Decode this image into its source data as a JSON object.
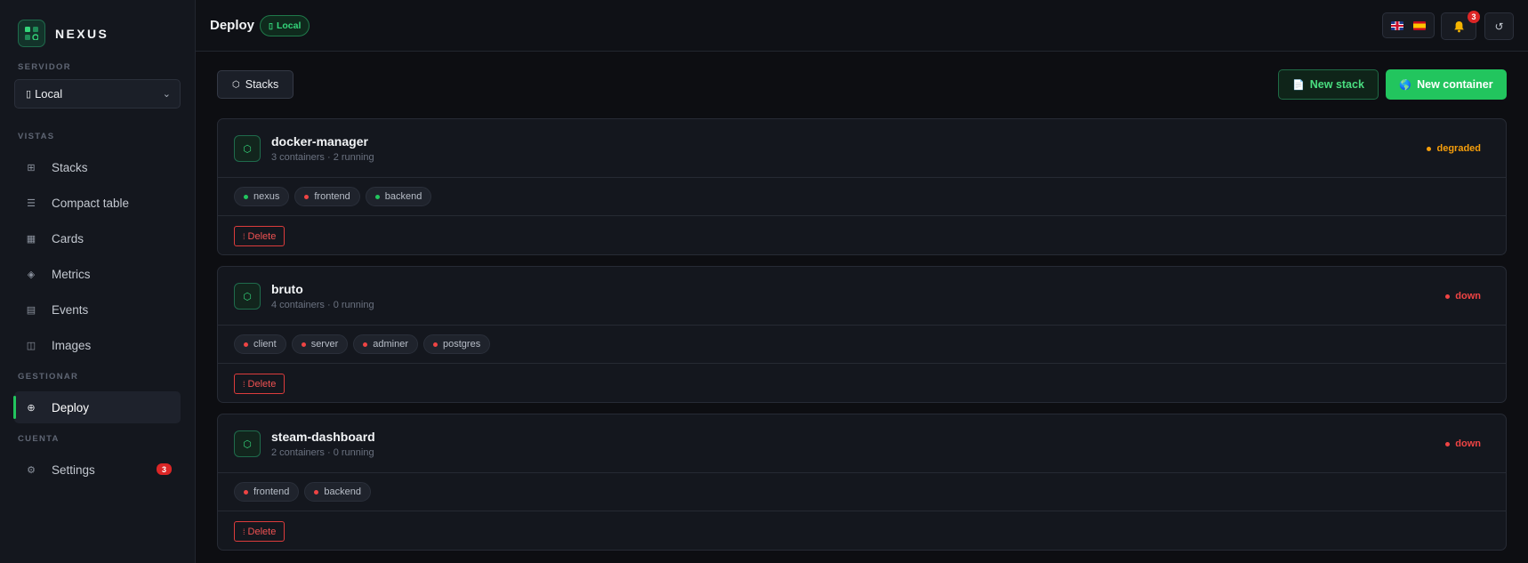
{
  "brand": {
    "name": "NEXUS",
    "logo_icon": "grid-logo-icon"
  },
  "sidebar": {
    "server_label": "SERVIDOR",
    "server_select": {
      "icon": "server-icon",
      "value": "Local"
    },
    "views_label": "VISTAS",
    "manage_label": "GESTIONAR",
    "account_label": "CUENTA",
    "items": [
      {
        "label": "Stacks",
        "icon": "stacks-grid-icon"
      },
      {
        "label": "Compact table",
        "icon": "list-icon"
      },
      {
        "label": "Cards",
        "icon": "cards-icon"
      },
      {
        "label": "Metrics",
        "icon": "metrics-diamond-icon"
      },
      {
        "label": "Events",
        "icon": "events-log-icon"
      },
      {
        "label": "Images",
        "icon": "images-icon"
      },
      {
        "label": "Deploy",
        "icon": "deploy-target-icon",
        "active": true
      },
      {
        "label": "Settings",
        "icon": "settings-gear-icon",
        "badge": "3"
      }
    ]
  },
  "header": {
    "title": "Deploy",
    "env_badge": "Local",
    "languages": [
      "en",
      "es"
    ],
    "notifications_count": "3"
  },
  "toolbar": {
    "stacks_tab": "Stacks",
    "new_stack": "New stack",
    "new_container": "New container"
  },
  "stacks": [
    {
      "name": "docker-manager",
      "summary": "3 containers · 2 running",
      "status": "degraded",
      "status_color": "#f59e0b",
      "services": [
        {
          "name": "nexus",
          "color": "#22c55e"
        },
        {
          "name": "frontend",
          "color": "#ef4444"
        },
        {
          "name": "backend",
          "color": "#22c55e"
        }
      ],
      "delete_label": "Delete"
    },
    {
      "name": "bruto",
      "summary": "4 containers · 0 running",
      "status": "down",
      "status_color": "#ef4444",
      "services": [
        {
          "name": "client",
          "color": "#ef4444"
        },
        {
          "name": "server",
          "color": "#ef4444"
        },
        {
          "name": "adminer",
          "color": "#ef4444"
        },
        {
          "name": "postgres",
          "color": "#ef4444"
        }
      ],
      "delete_label": "Delete"
    },
    {
      "name": "steam-dashboard",
      "summary": "2 containers · 0 running",
      "status": "down",
      "status_color": "#ef4444",
      "services": [
        {
          "name": "frontend",
          "color": "#ef4444"
        },
        {
          "name": "backend",
          "color": "#ef4444"
        }
      ],
      "delete_label": "Delete"
    }
  ]
}
